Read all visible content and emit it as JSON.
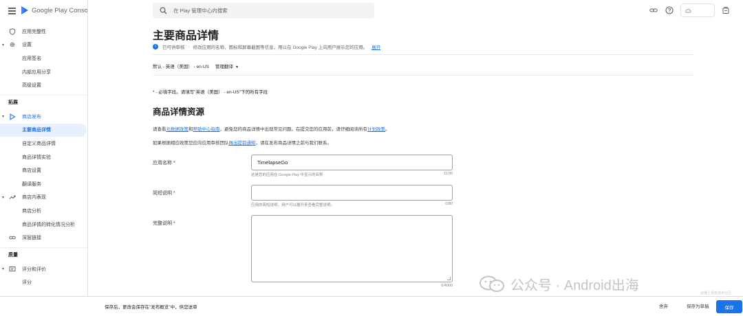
{
  "brand": {
    "name": "Google Play Console"
  },
  "search": {
    "placeholder": "在 Play 管理中心内搜索"
  },
  "sidebar": {
    "items": [
      {
        "label": "应用完整性",
        "icon": "shield-icon"
      },
      {
        "label": "设置",
        "icon": "gear-icon"
      },
      {
        "label": "应用签名"
      },
      {
        "label": "内部应用分享"
      },
      {
        "label": "高级设置"
      }
    ],
    "section_grow": "拓展",
    "grow_items": [
      {
        "label": "商店发布",
        "icon": "store-play-icon"
      },
      {
        "label": "主要商品详情"
      },
      {
        "label": "自定义商品详情"
      },
      {
        "label": "商品详情实验"
      },
      {
        "label": "商店设置"
      },
      {
        "label": "翻译服务"
      },
      {
        "label": "商店内表现",
        "icon": "trending-up-icon"
      },
      {
        "label": "商店分析"
      },
      {
        "label": "商品详情的转化情况分析"
      },
      {
        "label": "深层链接",
        "icon": "link-icon"
      }
    ],
    "section_quality": "质量",
    "quality_items": [
      {
        "label": "评分和评价",
        "icon": "review-icon"
      },
      {
        "label": "评分"
      }
    ]
  },
  "main": {
    "title": "主要商品详情",
    "status": {
      "state": "已可供审核",
      "text": "修改应用的名称、图标和屏幕截图等信息，用以在 Google Play 上向用户展示您的应用。",
      "expand": "展开"
    },
    "language": {
      "current": "默认 - 英语（美国） - en-US",
      "manage": "管理翻译"
    },
    "required_note": "* - 必填字段。请填写\"英语（美国） - en-US\"下的所有字段",
    "section_title": "商品详情资源",
    "para1": {
      "a": "请查看",
      "link1": "元数据政策",
      "b": "和",
      "link2": "帮助中心指南",
      "c": "，避免您的商品详情中出现常见问题。在提交您的应用前，请仔细阅读所有",
      "link3": "计划政策",
      "d": "。"
    },
    "para2": {
      "a": "如果根据相应政策您应向应用审核团队",
      "link": "做出提前通知",
      "b": "，请在发布商品详情之前与我们联系。"
    },
    "fields": {
      "app_name": {
        "label": "应用名称 *",
        "value": "TimelapseGo",
        "hint": "这是您的应用在 Google Play 中显示的名称",
        "count": "11/30"
      },
      "short_desc": {
        "label": "简短说明 *",
        "value": "",
        "hint": "应用的简短说明，用户可以展开来查看完整说明。",
        "count": "0/80"
      },
      "full_desc": {
        "label": "完整说明 *",
        "value": "",
        "count": "0/4000"
      }
    }
  },
  "watermark": {
    "text": "公众号 · Android出海",
    "small": "@稀土掘金技术社区"
  },
  "bottombar": {
    "message": "保存后，更改会保存在\"发布概览\"中，供您送审",
    "discard": "舍弃",
    "save_draft": "保存为草稿",
    "save": "保存"
  },
  "colors": {
    "accent": "#1a73e8",
    "active_bg": "#e8f0fe"
  }
}
